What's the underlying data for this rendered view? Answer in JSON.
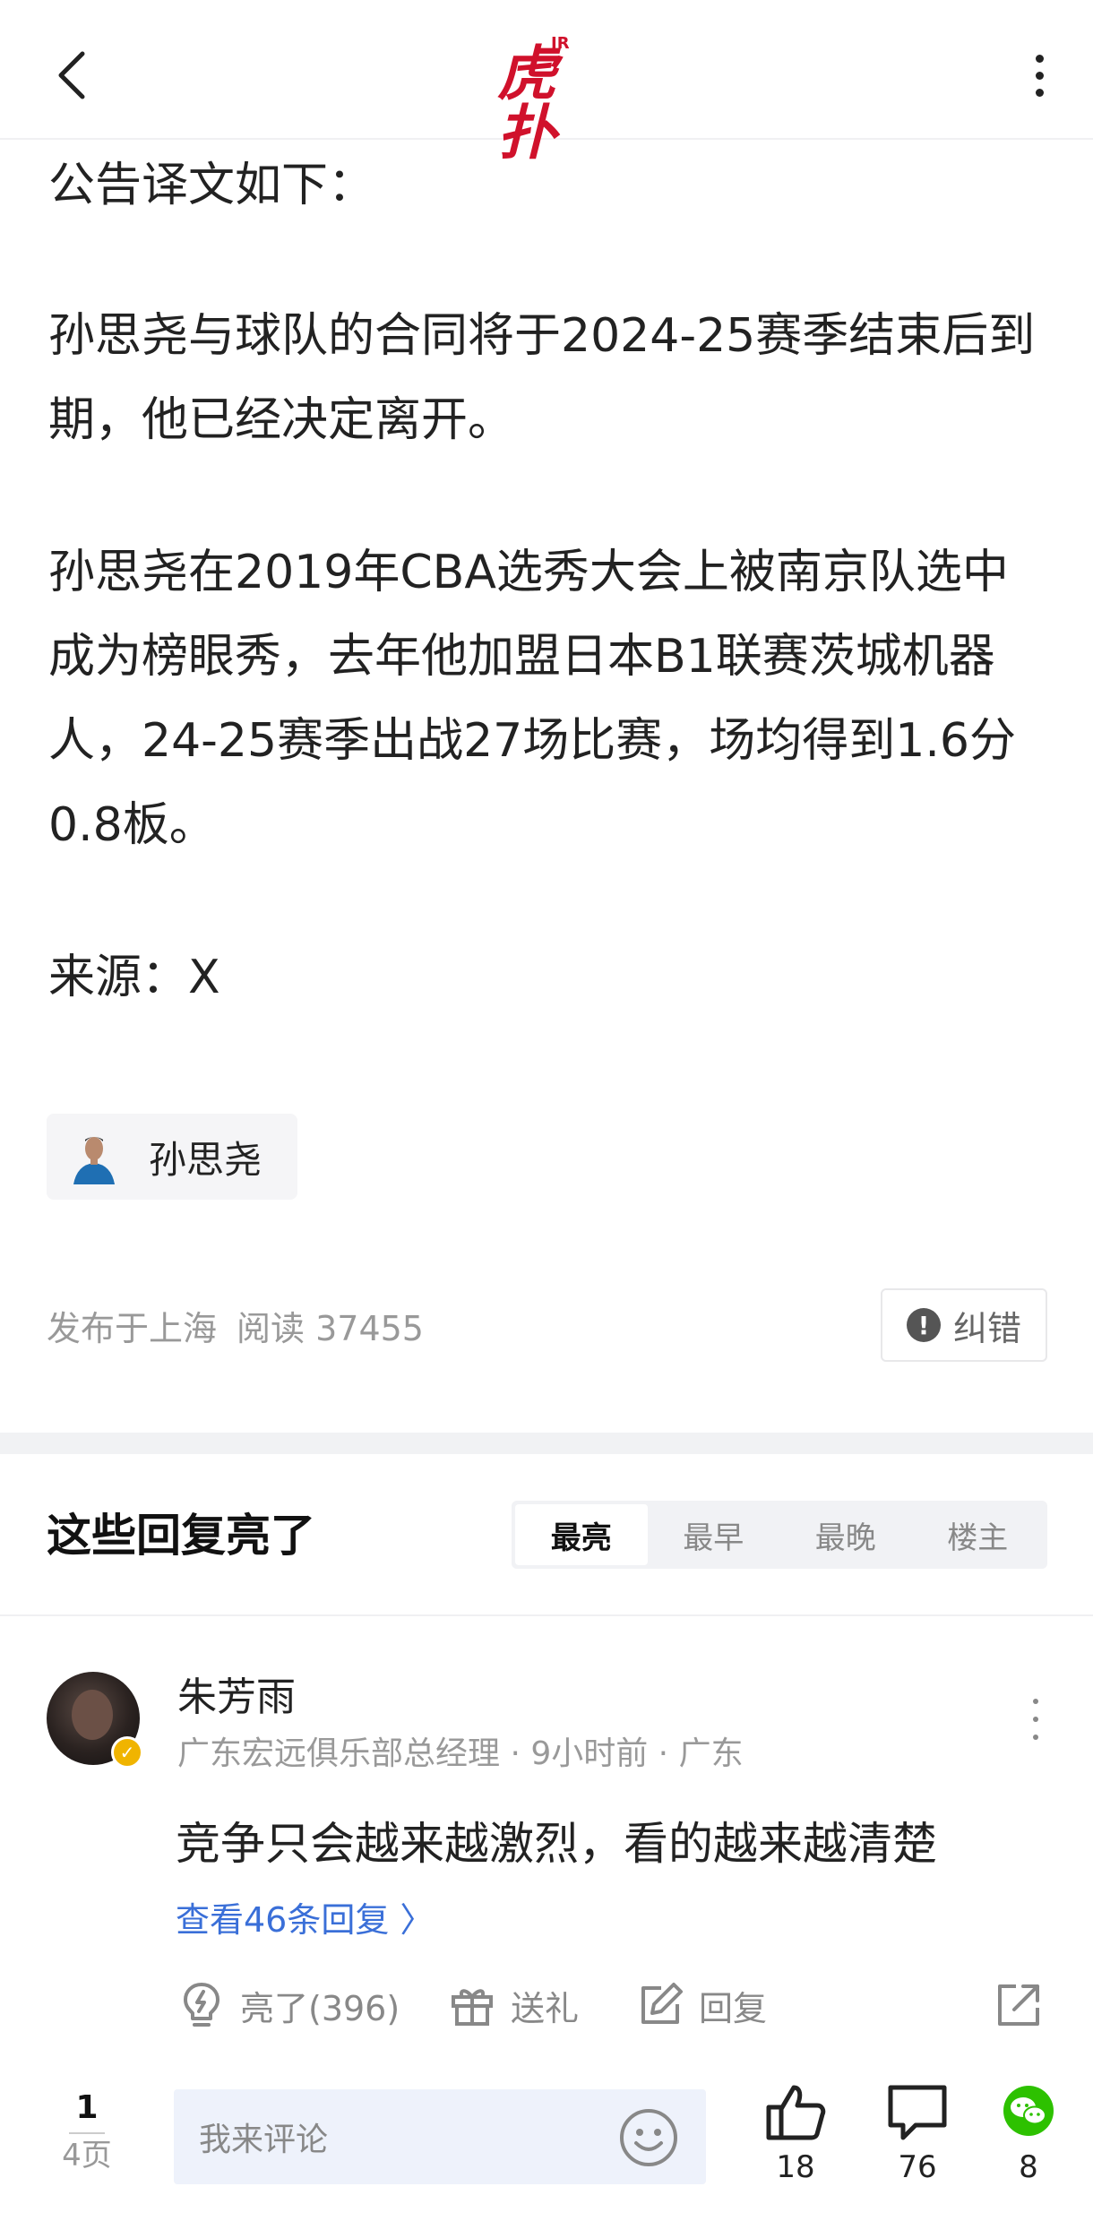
{
  "header": {
    "logo_small": "JR",
    "logo_main": "虎扑"
  },
  "article": {
    "p1": "公告译文如下：",
    "p2": "孙思尧与球队的合同将于2024-25赛季结束后到期，他已经决定离开。",
    "p3": "孙思尧在2019年CBA选秀大会上被南京队选中成为榜眼秀，去年他加盟日本B1联赛茨城机器人，24-25赛季出战27场比赛，场均得到1.6分0.8板。",
    "p4": "来源：X",
    "player_tag": "孙思尧",
    "location": "发布于上海",
    "read_label": "阅读 37455",
    "report_label": "纠错"
  },
  "comments_section": {
    "title": "这些回复亮了",
    "tabs": [
      "最亮",
      "最早",
      "最晚",
      "楼主"
    ],
    "active_tab": "最亮"
  },
  "comment": {
    "name": "朱芳雨",
    "meta": "广东宏远俱乐部总经理 · 9小时前 · 广东",
    "text": "竞争只会越来越激烈，看的越来越清楚",
    "replies_link": "查看46条回复 〉",
    "light_label": "亮了(396)",
    "gift_label": "送礼",
    "reply_label": "回复"
  },
  "bottom_bar": {
    "page_current": "1",
    "page_total": "4页",
    "input_placeholder": "我来评论",
    "like_count": "18",
    "comment_count": "76",
    "wechat_count": "8"
  },
  "colors": {
    "brand_red": "#d0112b",
    "link_blue": "#3a6fd8",
    "wechat_green": "#2dc100"
  }
}
